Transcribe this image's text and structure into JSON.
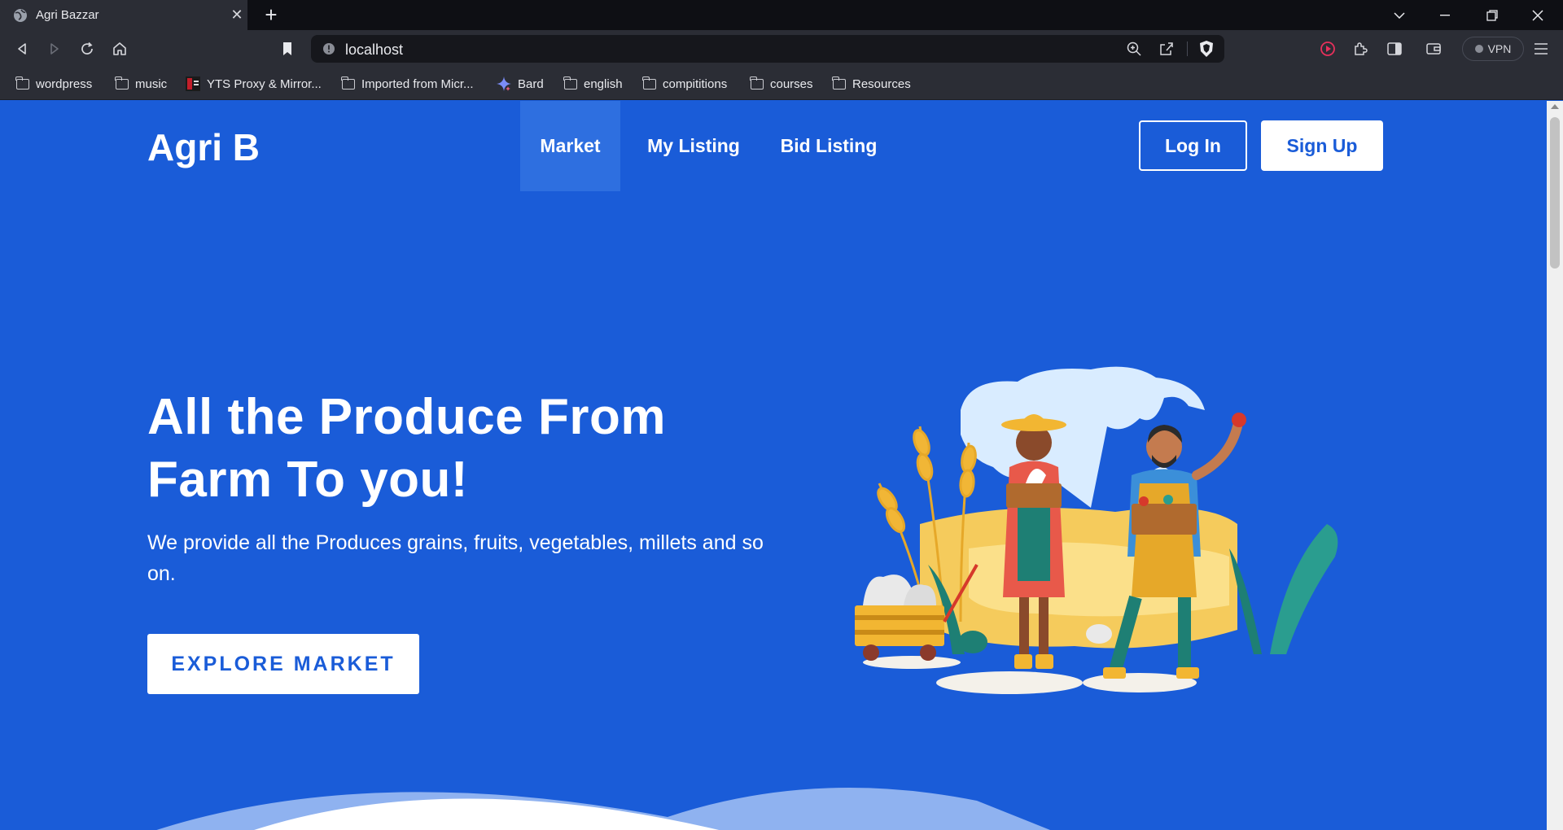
{
  "browser": {
    "tab_title": "Agri Bazzar",
    "url": "localhost",
    "vpn_label": "VPN",
    "bookmarks": [
      {
        "label": "wordpress",
        "icon": "folder-icon"
      },
      {
        "label": "music",
        "icon": "folder-icon"
      },
      {
        "label": "YTS Proxy & Mirror...",
        "icon": "yts-favicon-icon"
      },
      {
        "label": "Imported from Micr...",
        "icon": "folder-icon"
      },
      {
        "label": "Bard",
        "icon": "bard-sparkle-icon"
      },
      {
        "label": "english",
        "icon": "folder-icon"
      },
      {
        "label": "compititions",
        "icon": "folder-icon"
      },
      {
        "label": "courses",
        "icon": "folder-icon"
      },
      {
        "label": "Resources",
        "icon": "folder-icon"
      }
    ]
  },
  "site": {
    "brand": "Agri B",
    "nav": [
      {
        "label": "Market",
        "active": true
      },
      {
        "label": "My Listing",
        "active": false
      },
      {
        "label": "Bid Listing",
        "active": false
      }
    ],
    "login_label": "Log In",
    "signup_label": "Sign Up"
  },
  "hero": {
    "title_line1": "All the Produce From",
    "title_line2": "Farm To you!",
    "subtitle": "We provide all the Produces grains, fruits, vegetables, millets and so on.",
    "cta_label": "EXPLORE MARKET",
    "illustration": "farmers-illustration"
  },
  "colors": {
    "primary": "#1a5cd8",
    "active_nav": "#2e6fe0",
    "white": "#ffffff"
  }
}
